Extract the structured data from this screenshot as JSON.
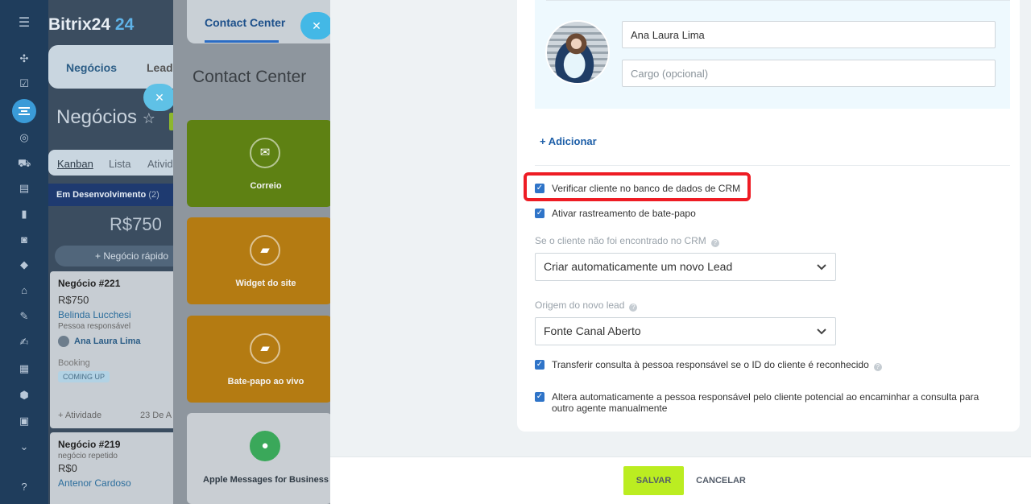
{
  "crm": {
    "logo_text": "Bitrix24",
    "logo_num": "24",
    "tabs": [
      {
        "label": "Negócios"
      },
      {
        "label": "Leads"
      }
    ],
    "page_title": "Negócios",
    "views": [
      {
        "label": "Kanban"
      },
      {
        "label": "Lista"
      },
      {
        "label": "Atividades"
      }
    ],
    "column": {
      "title": "Em Desenvolvimento",
      "count": "(2)",
      "sum": "R$750",
      "quick_add": "+ Negócio rápido"
    },
    "deals": [
      {
        "title": "Negócio #221",
        "amount": "R$750",
        "client": "Belinda Lucchesi",
        "responsible_label": "Pessoa responsável",
        "person": "Ana Laura Lima",
        "booking": "Booking",
        "badge": "COMING UP",
        "activity": "+ Atividade",
        "date": "23 De A"
      },
      {
        "title": "Negócio #219",
        "note": "negócio repetido",
        "amount": "R$0",
        "client": "Antenor Cardoso"
      }
    ]
  },
  "contact_center": {
    "tab_label": "Contact Center",
    "title": "Contact Center",
    "tiles": [
      {
        "label": "Correio",
        "icon": "mail-icon"
      },
      {
        "label": "Widget do site",
        "icon": "chat-icon"
      },
      {
        "label": "Bate-papo ao vivo",
        "icon": "chat-icon"
      },
      {
        "label": "Apple Messages for Business",
        "icon": "message-icon"
      }
    ]
  },
  "form": {
    "contact_name": "Ana Laura Lima",
    "role_placeholder": "Cargo (opcional)",
    "add_link": "+ Adicionar",
    "check_crm": "Verificar cliente no banco de dados de CRM",
    "check_tracking": "Ativar rastreamento de bate-papo",
    "not_found_label": "Se o cliente não foi encontrado no CRM",
    "not_found_value": "Criar automaticamente um novo Lead",
    "origin_label": "Origem do novo lead",
    "origin_value": "Fonte Canal Aberto",
    "check_transfer": "Transferir consulta à pessoa responsável se o ID do cliente é reconhecido",
    "check_auto": "Altera automaticamente a pessoa responsável pelo cliente potencial ao encaminhar a consulta para outro agente manualmente"
  },
  "footer": {
    "save_label": "SALVAR",
    "cancel_label": "CANCELAR"
  },
  "colors": {
    "accent": "#2f74c8",
    "save": "#bbed21",
    "highlight": "#ee1c24"
  }
}
